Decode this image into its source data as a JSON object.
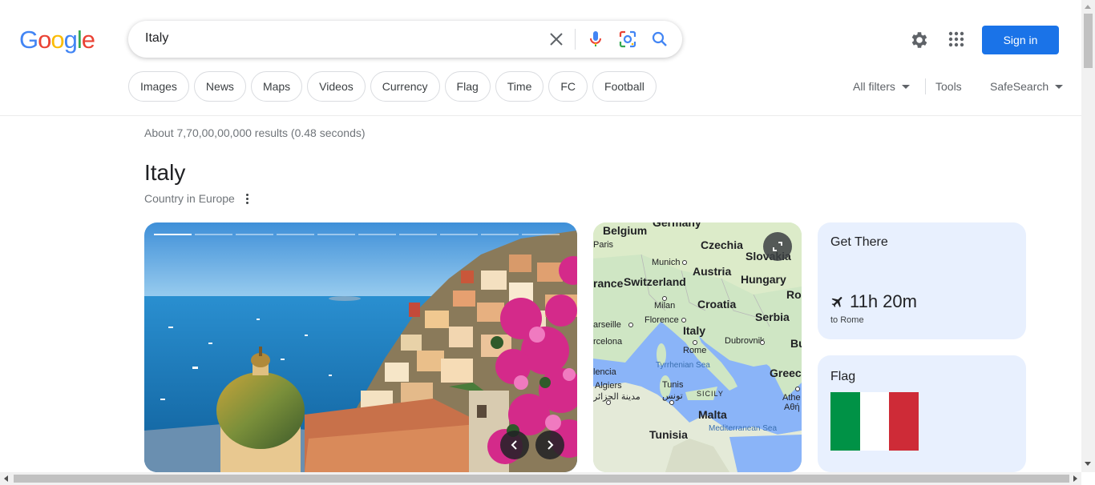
{
  "brand": {
    "letters": [
      {
        "ch": "G",
        "color": "#4285f4"
      },
      {
        "ch": "o",
        "color": "#ea4335"
      },
      {
        "ch": "o",
        "color": "#fbbc05"
      },
      {
        "ch": "g",
        "color": "#4285f4"
      },
      {
        "ch": "l",
        "color": "#34a853"
      },
      {
        "ch": "e",
        "color": "#ea4335"
      }
    ],
    "accent": "#1a73e8"
  },
  "search": {
    "query": "Italy",
    "icons": [
      "clear-icon",
      "microphone-icon",
      "lens-icon",
      "search-icon"
    ]
  },
  "header": {
    "settings_icon": "gear-icon",
    "apps_icon": "apps-grid-icon",
    "signin_label": "Sign in"
  },
  "chips": [
    "Images",
    "News",
    "Maps",
    "Videos",
    "Currency",
    "Flag",
    "Time",
    "FC",
    "Football"
  ],
  "filters": {
    "all_filters": "All filters",
    "tools": "Tools",
    "safesearch": "SafeSearch"
  },
  "results": {
    "stats": "About 7,70,00,00,000 results (0.48 seconds)"
  },
  "knowledge_panel": {
    "title": "Italy",
    "subtitle": "Country in Europe",
    "carousel": {
      "slide_count": 10,
      "active_index": 0,
      "prev_icon": "chevron-left-icon",
      "next_icon": "chevron-right-icon"
    },
    "map": {
      "expand_icon": "expand-icon",
      "countries": [
        "Germany",
        "Belgium",
        "Czechia",
        "Slovakia",
        "Austria",
        "Hungary",
        "rance",
        "Switzerland",
        "Croatia",
        "Ror",
        "Serbia",
        "Italy",
        "Bu",
        "Greece",
        "Malta",
        "Tunisia"
      ],
      "cities": [
        "Paris",
        "Munich",
        "Milan",
        "Florence",
        "arseille",
        "rcelona",
        "Rome",
        "Dubrovnik",
        "lencia",
        "Algiers",
        "مدينة الجزائر",
        "Tunis",
        "تونس",
        "SICILY",
        "Athe",
        "Αθή"
      ],
      "seas": [
        "Tyrrhenian Sea",
        "Mediterranean Sea"
      ]
    },
    "get_there": {
      "title": "Get There",
      "time": "11h 20m",
      "destination": "to Rome",
      "icon": "airplane-icon"
    },
    "flag": {
      "title": "Flag",
      "colors": [
        "#009246",
        "#ffffff",
        "#ce2b37"
      ]
    }
  }
}
